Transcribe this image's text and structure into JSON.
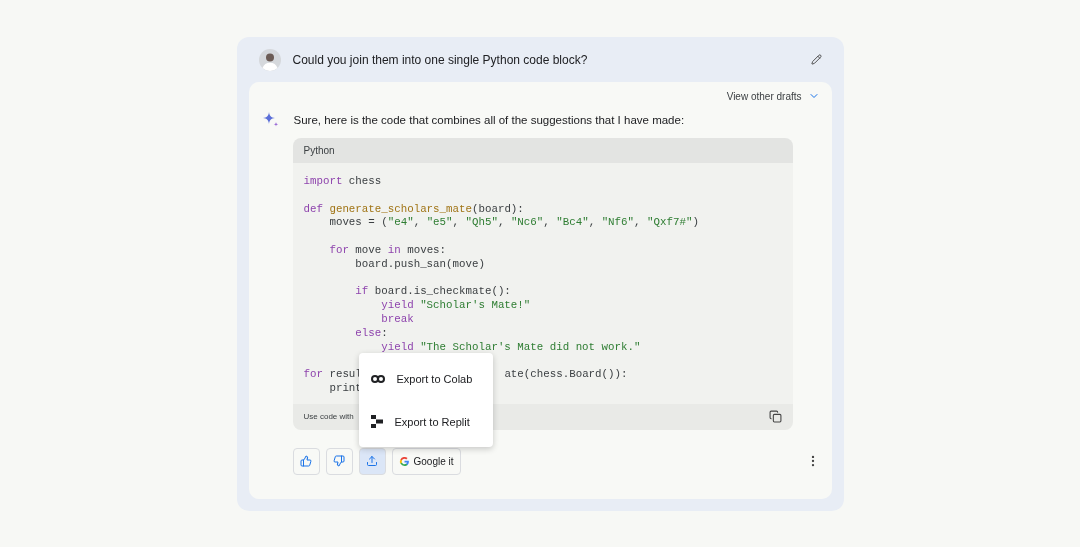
{
  "prompt": {
    "text": "Could you join them into one single Python code block?"
  },
  "response": {
    "drafts_label": "View other drafts",
    "intro": "Sure, here is the code that combines all of the suggestions that I have made:",
    "code_block": {
      "language": "Python",
      "paragraphs": [
        [
          [
            {
              "kind": "keyword",
              "text": "import"
            },
            {
              "kind": "plain",
              "text": " chess"
            }
          ]
        ],
        [
          [
            {
              "kind": "keyword",
              "text": "def"
            },
            {
              "kind": "function",
              "text": " generate_scholars_mate"
            },
            {
              "kind": "plain",
              "text": "(board):"
            }
          ],
          [
            {
              "kind": "plain",
              "text": "    moves = ("
            },
            {
              "kind": "string",
              "text": "\"e4\""
            },
            {
              "kind": "plain",
              "text": ", "
            },
            {
              "kind": "string",
              "text": "\"e5\""
            },
            {
              "kind": "plain",
              "text": ", "
            },
            {
              "kind": "string",
              "text": "\"Qh5\""
            },
            {
              "kind": "plain",
              "text": ", "
            },
            {
              "kind": "string",
              "text": "\"Nc6\""
            },
            {
              "kind": "plain",
              "text": ", "
            },
            {
              "kind": "string",
              "text": "\"Bc4\""
            },
            {
              "kind": "plain",
              "text": ", "
            },
            {
              "kind": "string",
              "text": "\"Nf6\""
            },
            {
              "kind": "plain",
              "text": ", "
            },
            {
              "kind": "string",
              "text": "\"Qxf7#\""
            },
            {
              "kind": "plain",
              "text": ")"
            }
          ]
        ],
        [
          [
            {
              "kind": "keyword",
              "text": "    for"
            },
            {
              "kind": "plain",
              "text": " move "
            },
            {
              "kind": "keyword",
              "text": "in"
            },
            {
              "kind": "plain",
              "text": " moves:"
            }
          ],
          [
            {
              "kind": "plain",
              "text": "        board.push_san(move)"
            }
          ]
        ],
        [
          [
            {
              "kind": "keyword",
              "text": "        if"
            },
            {
              "kind": "plain",
              "text": " board.is_checkmate():"
            }
          ],
          [
            {
              "kind": "keyword",
              "text": "            yield"
            },
            {
              "kind": "string",
              "text": " \"Scholar's Mate!\""
            }
          ],
          [
            {
              "kind": "keyword",
              "text": "            break"
            }
          ],
          [
            {
              "kind": "keyword",
              "text": "        else"
            },
            {
              "kind": "plain",
              "text": ":"
            }
          ],
          [
            {
              "kind": "keyword",
              "text": "            yield"
            },
            {
              "kind": "string",
              "text": " \"The Scholar's Mate did not work.\""
            }
          ]
        ],
        [
          [
            {
              "kind": "keyword",
              "text": "for"
            },
            {
              "kind": "plain",
              "text": " resul"
            },
            {
              "kind": "hidden"
            },
            {
              "kind": "plain",
              "text": "ate(chess.Board()):"
            }
          ],
          [
            {
              "kind": "plain",
              "text": "    print"
            }
          ]
        ]
      ],
      "footer": "Use code with"
    },
    "export_menu": [
      {
        "kind": "colab",
        "label": "Export to Colab"
      },
      {
        "kind": "replit",
        "label": "Export to Replit"
      }
    ],
    "actions": [
      {
        "kind": "thumbs_up",
        "selected": false
      },
      {
        "kind": "thumbs_down",
        "selected": false
      },
      {
        "kind": "share",
        "selected": true
      },
      {
        "kind": "google",
        "label": "Google it",
        "selected": false
      }
    ]
  }
}
